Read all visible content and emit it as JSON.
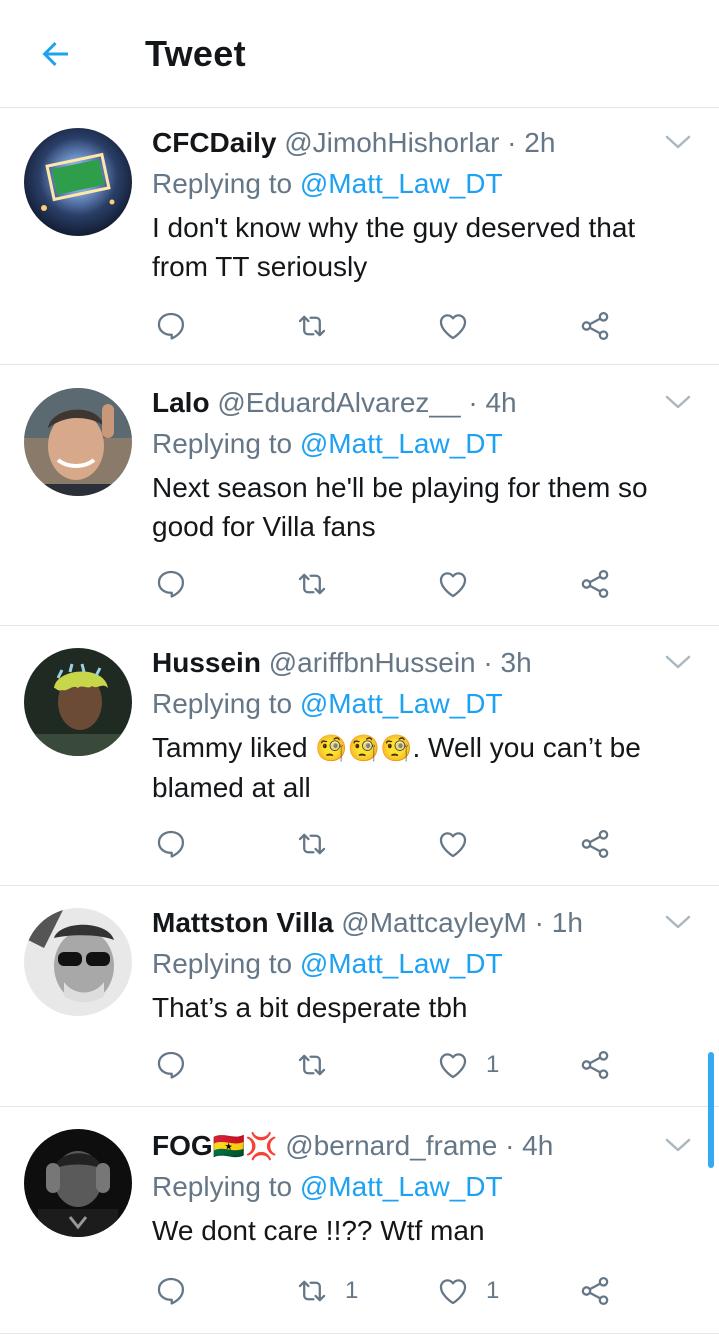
{
  "header": {
    "title": "Tweet",
    "back_icon": "arrow-left-icon",
    "accent": "#1da1f2"
  },
  "replying_prefix": "Replying to",
  "tweets": [
    {
      "name": "CFCDaily",
      "flags": "",
      "handle": "@JimohHishorlar",
      "time": "2h",
      "reply_to": "@Matt_Law_DT",
      "text": "I don't know why the guy deserved that from TT seriously",
      "retweets": "",
      "likes": ""
    },
    {
      "name": "Lalo",
      "flags": "",
      "handle": "@EduardAlvarez__",
      "time": "4h",
      "reply_to": "@Matt_Law_DT",
      "text": "Next season he'll be playing for them so good for Villa fans",
      "retweets": "",
      "likes": ""
    },
    {
      "name": "Hussein",
      "flags": "",
      "handle": "@ariffbnHussein",
      "time": "3h",
      "reply_to": "@Matt_Law_DT",
      "text_before": "Tammy liked ",
      "emojis": "🧐🧐🧐",
      "text_after": ". Well you can’t be blamed at all",
      "retweets": "",
      "likes": ""
    },
    {
      "name": "Mattston Villa",
      "flags": "",
      "handle": "@MattcayleyM",
      "time": "1h",
      "reply_to": "@Matt_Law_DT",
      "text": "That’s a bit desperate tbh",
      "retweets": "",
      "likes": "1"
    },
    {
      "name": "FOG",
      "flags": "🇬🇭💢",
      "handle": "@bernard_frame",
      "time": "4h",
      "reply_to": "@Matt_Law_DT",
      "text": "We dont care !!?? Wtf man",
      "retweets": "1",
      "likes": "1"
    }
  ],
  "dot": "·"
}
